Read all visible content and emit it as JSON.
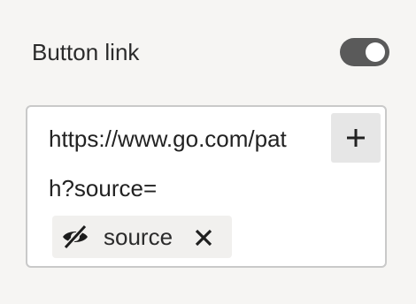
{
  "settings": {
    "button_link": {
      "label": "Button link",
      "enabled": true
    },
    "url_field": {
      "lines": [
        "https://www.go.com/pat",
        "h?source="
      ],
      "add_icon": "plus-icon",
      "tokens": [
        {
          "label": "source",
          "icon": "eye-off-icon",
          "remove_icon": "close-icon"
        }
      ]
    }
  }
}
